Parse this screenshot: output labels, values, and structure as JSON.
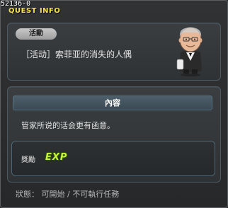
{
  "quest_id": "52136-0",
  "title": "QUEST INFO",
  "category_badge": "活動",
  "quest_name": "［活动］索菲亚的消失的人偶",
  "npc_icon": "butler-npc-portrait",
  "content_header": "內容",
  "content_text": "管家所说的话会更有函意。",
  "reward_label": "獎勵",
  "reward_type": "EXP",
  "status_text": "狀態： 可開始 / 不可執行任務",
  "colors": {
    "title": "#f6e24a",
    "exp": "#c8f03c"
  }
}
